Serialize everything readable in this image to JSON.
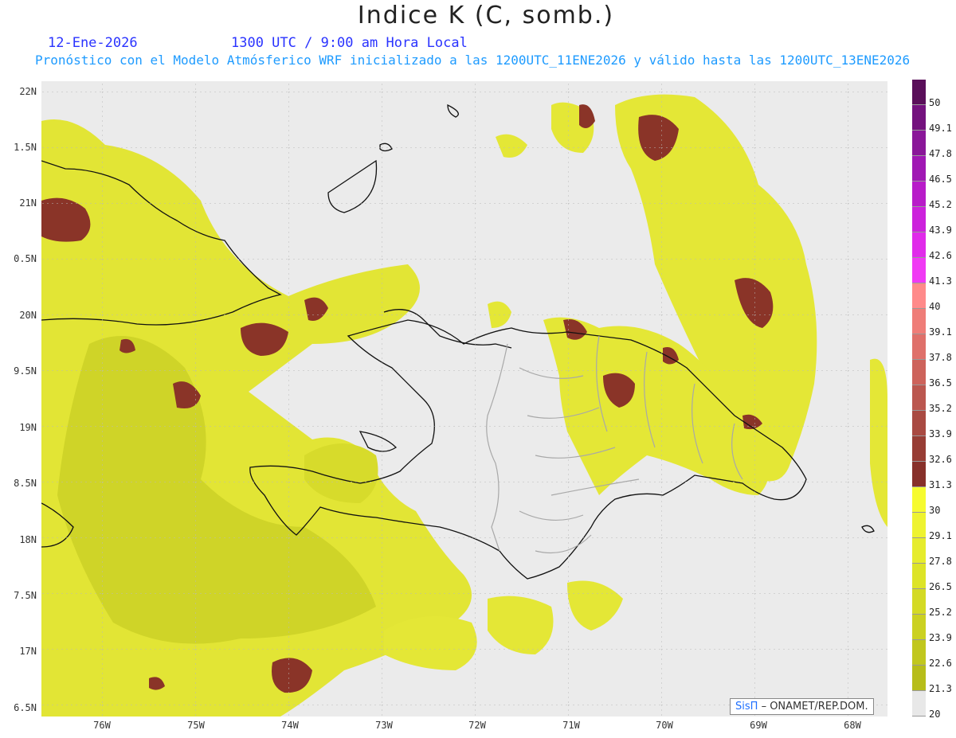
{
  "header": {
    "title": "Indice K (C, somb.)",
    "date": "12-Ene-2026",
    "time": "1300 UTC / 9:00 am Hora Local",
    "description": "Pronóstico con el Modelo Atmósferico WRF inicializado a las 1200UTC_11ENE2026 y válido hasta las  1200UTC_13ENE2026"
  },
  "axes": {
    "lat_labels": [
      "22N",
      "1.5N",
      "21N",
      "0.5N",
      "20N",
      "9.5N",
      "19N",
      "8.5N",
      "18N",
      "7.5N",
      "17N",
      "6.5N"
    ],
    "lon_labels": [
      "76W",
      "75W",
      "74W",
      "73W",
      "72W",
      "71W",
      "70W",
      "69W",
      "68W"
    ]
  },
  "colorbar": {
    "labels": [
      "50",
      "49.1",
      "47.8",
      "46.5",
      "45.2",
      "43.9",
      "42.6",
      "41.3",
      "40",
      "39.1",
      "37.8",
      "36.5",
      "35.2",
      "33.9",
      "32.6",
      "31.3",
      "30",
      "29.1",
      "27.8",
      "26.5",
      "25.2",
      "23.9",
      "22.6",
      "21.3",
      "20"
    ],
    "colors": [
      "#5a0f5a",
      "#74127e",
      "#8a1799",
      "#a018b4",
      "#b81cc9",
      "#cc22dc",
      "#e02bea",
      "#f03af4",
      "#ff8a8a",
      "#ef7d78",
      "#df706a",
      "#cd635b",
      "#bb574f",
      "#a94a42",
      "#983d35",
      "#87302a",
      "#f6fb2f",
      "#eef330",
      "#e6ec2c",
      "#dde427",
      "#d4da24",
      "#cbd121",
      "#c1c71d",
      "#b7bd19",
      "#e8e8e8"
    ]
  },
  "credit": {
    "sis": "SisΠ",
    "org": "– ONAMET/REP.DOM."
  }
}
